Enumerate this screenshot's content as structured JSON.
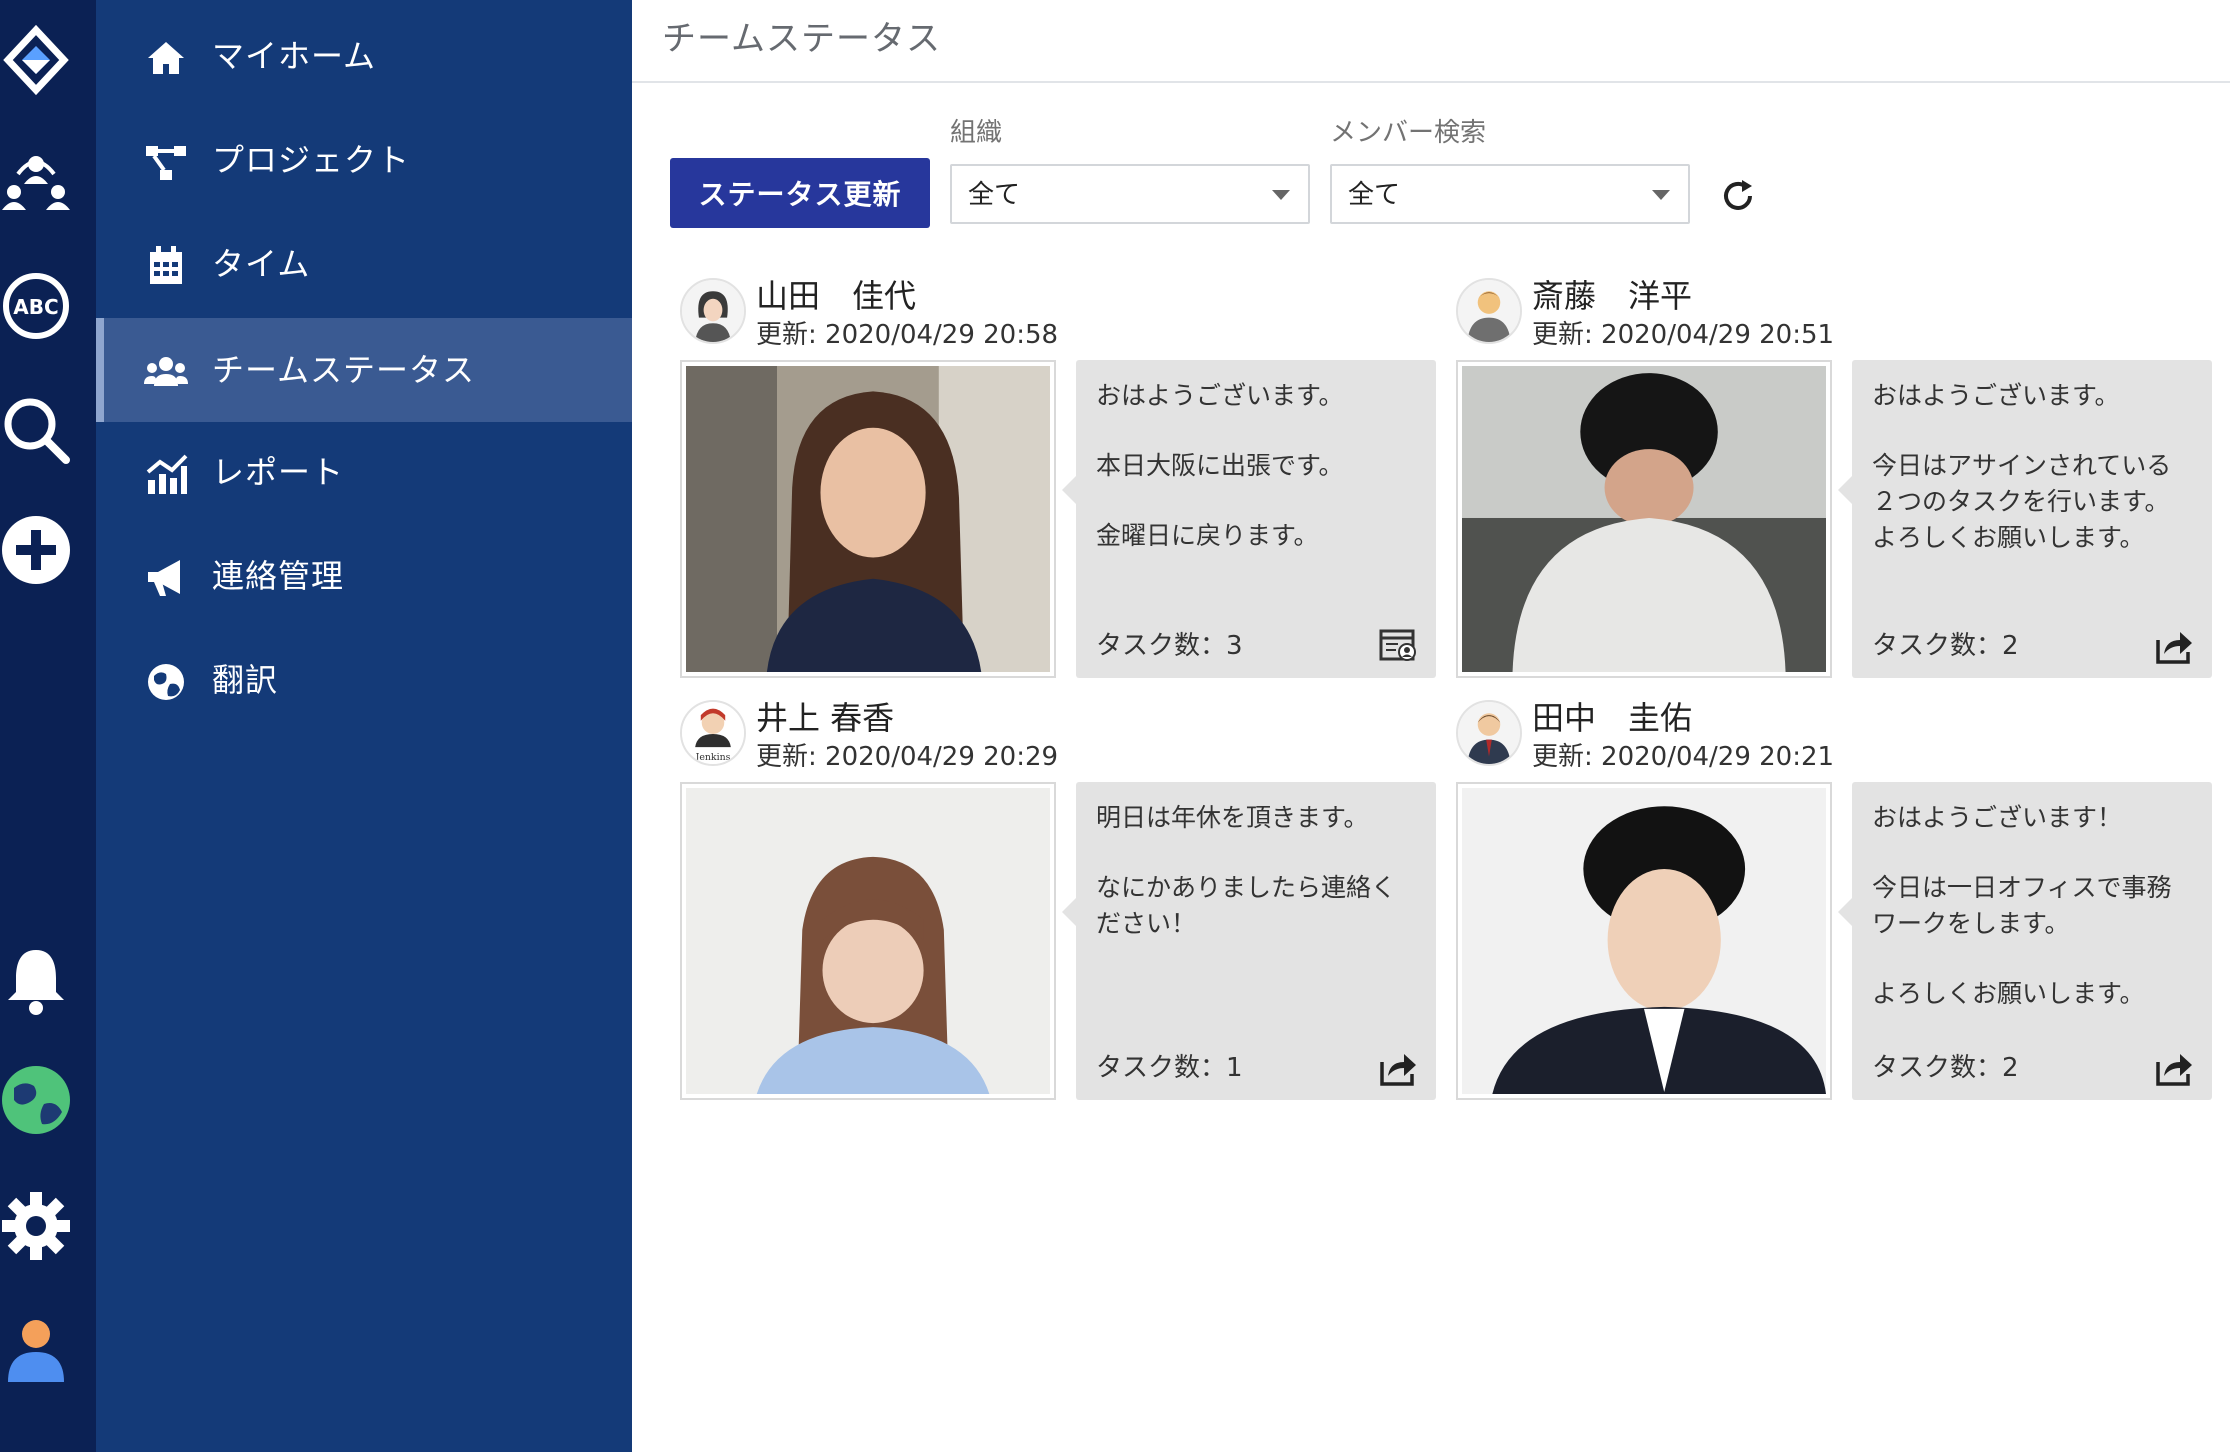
{
  "rail": {
    "icons": [
      "logo-icon",
      "team-icon",
      "abc-icon",
      "search-icon",
      "add-icon",
      "bell-icon",
      "globe-icon",
      "settings-icon",
      "user-icon"
    ]
  },
  "sidebar": {
    "items": [
      {
        "label": "マイホーム",
        "icon": "home-icon"
      },
      {
        "label": "プロジェクト",
        "icon": "project-icon"
      },
      {
        "label": "タイム",
        "icon": "calendar-icon"
      },
      {
        "label": "チームステータス",
        "icon": "users-icon",
        "active": true
      },
      {
        "label": "レポート",
        "icon": "chart-icon"
      },
      {
        "label": "連絡管理",
        "icon": "megaphone-icon"
      },
      {
        "label": "翻訳",
        "icon": "globe-icon"
      }
    ]
  },
  "header": {
    "title": "チームステータス"
  },
  "toolbar": {
    "update_label": "ステータス更新",
    "org_label": "組織",
    "org_value": "全て",
    "member_label": "メンバー検索",
    "member_value": "全て"
  },
  "members": [
    {
      "name": "山田　佳代",
      "updated": "更新: 2020/04/29 20:58",
      "message": [
        "おはようございます。",
        "",
        "本日大阪に出張です。",
        "",
        "金曜日に戻ります。"
      ],
      "tasks": "タスク数：3",
      "action_icon": "calendar-user-icon"
    },
    {
      "name": "斎藤　洋平",
      "updated": "更新: 2020/04/29 20:51",
      "message": [
        "おはようございます。",
        "",
        "今日はアサインされている",
        "２つのタスクを行います。",
        "よろしくお願いします。"
      ],
      "tasks": "タスク数：2",
      "action_icon": "share-icon"
    },
    {
      "name": "井上 春香",
      "updated": "更新: 2020/04/29 20:29",
      "message": [
        "明日は年休を頂きます。",
        "",
        "なにかありましたら連絡く",
        "ださい！"
      ],
      "tasks": "タスク数：1",
      "action_icon": "share-icon"
    },
    {
      "name": "田中　圭佑",
      "updated": "更新: 2020/04/29 20:21",
      "message": [
        "おはようございます！",
        "",
        "今日は一日オフィスで事務",
        "ワークをします。",
        "",
        "よろしくお願いします。"
      ],
      "tasks": "タスク数：2",
      "action_icon": "share-icon"
    }
  ],
  "colors": {
    "rail": "#0b2154",
    "sidebar": "#143a78",
    "active": "#3a5a92",
    "button": "#27379c",
    "bubble": "#e3e3e3"
  }
}
